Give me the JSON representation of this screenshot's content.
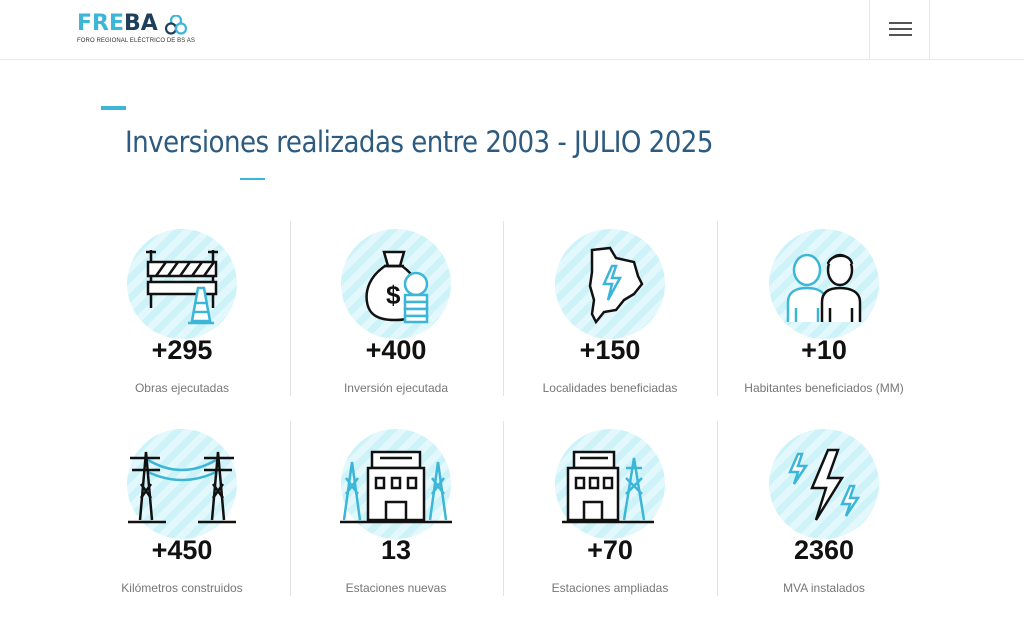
{
  "header": {
    "logo_fre": "FRE",
    "logo_ba": "BA",
    "logo_subtitle": "FORO REGIONAL ELÉCTRICO DE BS AS",
    "menu_icon": "hamburger-icon"
  },
  "colors": {
    "accent": "#3cb6d8",
    "title": "#2d5b80",
    "circle": "#cdf3f9"
  },
  "section": {
    "title": "Inversiones realizadas entre 2003 - JULIO 2025"
  },
  "stats": [
    {
      "icon": "road-barrier-icon",
      "value": "+295",
      "label": "Obras ejecutadas"
    },
    {
      "icon": "money-bag-icon",
      "value": "+400",
      "label": "Inversión ejecutada"
    },
    {
      "icon": "province-map-bolt-icon",
      "value": "+150",
      "label": "Localidades beneficiadas"
    },
    {
      "icon": "people-icon",
      "value": "+10",
      "label": "Habitantes beneficiados (MM)"
    },
    {
      "icon": "power-line-towers-icon",
      "value": "+450",
      "label": "Kilómetros construidos"
    },
    {
      "icon": "substation-new-icon",
      "value": "13",
      "label": "Estaciones nuevas"
    },
    {
      "icon": "substation-expanded-icon",
      "value": "+70",
      "label": "Estaciones ampliadas"
    },
    {
      "icon": "lightning-bolts-icon",
      "value": "2360",
      "label": "MVA instalados"
    }
  ]
}
